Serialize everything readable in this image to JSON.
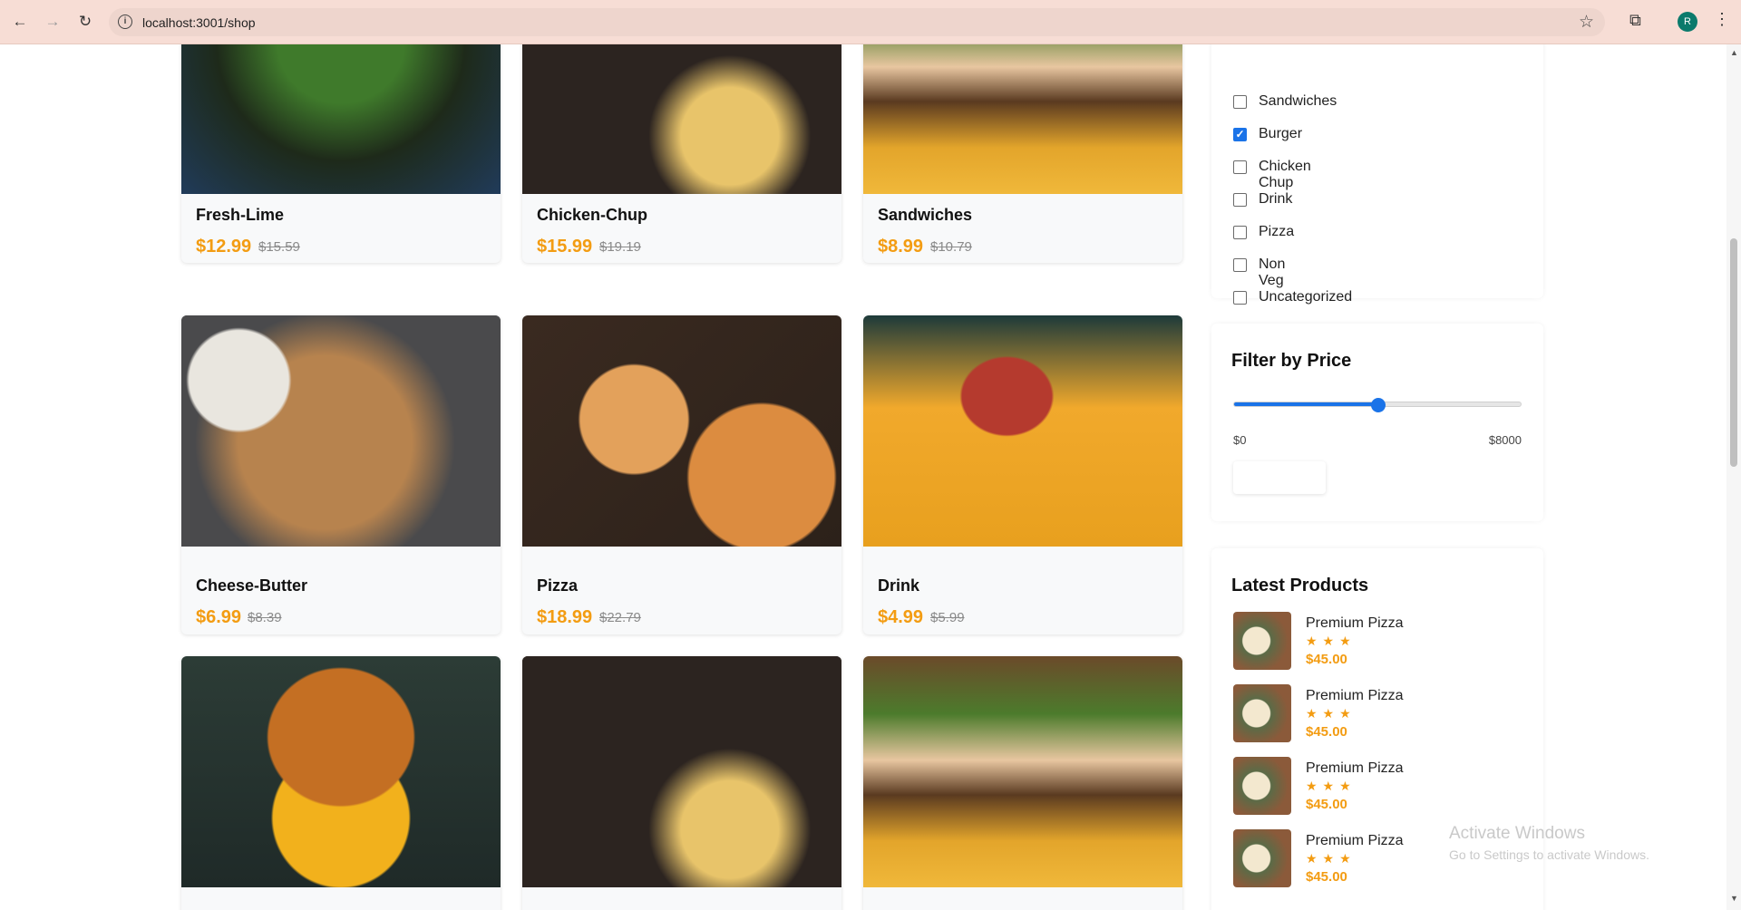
{
  "browser": {
    "url": "localhost:3001/shop",
    "avatar_letter": "R"
  },
  "products": [
    {
      "name": "Fresh-Lime",
      "price": "$12.99",
      "old_price": "$15.59",
      "image": "salad"
    },
    {
      "name": "Chicken-Chup",
      "price": "$15.99",
      "old_price": "$19.19",
      "image": "fried-chicken"
    },
    {
      "name": "Sandwiches",
      "price": "$8.99",
      "old_price": "$10.79",
      "image": "sandwich"
    },
    {
      "name": "Cheese-Butter",
      "price": "$6.99",
      "old_price": "$8.39",
      "image": "cheese-bread-board"
    },
    {
      "name": "Pizza",
      "price": "$18.99",
      "old_price": "$22.79",
      "image": "pizza-slices"
    },
    {
      "name": "Drink",
      "price": "$4.99",
      "old_price": "$5.99",
      "image": "cocktails"
    },
    {
      "image": "burger"
    },
    {
      "image": "fried-chicken"
    },
    {
      "image": "sandwich"
    }
  ],
  "categories": [
    {
      "label": "Sandwiches",
      "checked": false
    },
    {
      "label": "Burger",
      "checked": true
    },
    {
      "label": "Chicken Chup",
      "checked": false
    },
    {
      "label": "Drink",
      "checked": false
    },
    {
      "label": "Pizza",
      "checked": false
    },
    {
      "label": "Non Veg",
      "checked": false
    },
    {
      "label": "Uncategorized",
      "checked": false
    }
  ],
  "price_filter": {
    "title": "Filter by Price",
    "min_label": "$0",
    "max_label": "$8000",
    "slider_fraction": 0.5
  },
  "latest": {
    "title": "Latest Products",
    "items": [
      {
        "name": "Premium Pizza",
        "stars": "★★★",
        "price": "$45.00"
      },
      {
        "name": "Premium Pizza",
        "stars": "★★★",
        "price": "$45.00"
      },
      {
        "name": "Premium Pizza",
        "stars": "★★★",
        "price": "$45.00"
      },
      {
        "name": "Premium Pizza",
        "stars": "★★★",
        "price": "$45.00"
      }
    ]
  },
  "watermark": {
    "line1": "Activate Windows",
    "line2": "Go to Settings to activate Windows."
  },
  "colors": {
    "accent": "#1a73e8",
    "price": "#f39c12"
  }
}
